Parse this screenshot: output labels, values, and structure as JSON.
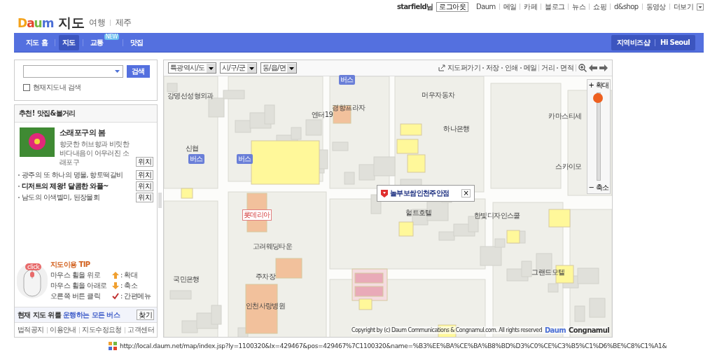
{
  "top_links": {
    "user": "starfield님",
    "logout": "로그아웃",
    "links": [
      "Daum",
      "메일",
      "카페",
      "블로그",
      "뉴스",
      "쇼핑",
      "d&shop",
      "동영상",
      "더보기"
    ]
  },
  "brand": {
    "logo": "Daum",
    "title": "지도",
    "sublinks": [
      "여행",
      "제주"
    ]
  },
  "nav": {
    "tabs": [
      {
        "label": "지도 홈",
        "selected": false
      },
      {
        "label": "지도",
        "selected": true
      },
      {
        "label": "교통",
        "selected": false,
        "badge": "NEW"
      },
      {
        "label": "맛집",
        "selected": false
      }
    ],
    "right_links": [
      "지역비즈샵",
      "Hi Seoul"
    ]
  },
  "search": {
    "button": "검색",
    "option_label": "현재지도내 검색",
    "option_checked": false
  },
  "recommend": {
    "title": "추천! 맛집&볼거리",
    "feature": {
      "title": "소래포구의 봄",
      "description": "향긋한 허브향과 비릿한 바다내음이 어우러진 소래포구",
      "button": "위치"
    },
    "items": [
      {
        "text": "광주의 또 하나의 명물, 향토떡갈비",
        "bold": false,
        "button": "위치"
      },
      {
        "text": "디저트의 제왕! 달콤한 와플~",
        "bold": true,
        "button": "위치"
      },
      {
        "text": "남도의 이색별미, 된장물회",
        "bold": false,
        "button": "위치"
      }
    ]
  },
  "tip": {
    "bubble": "click",
    "title": "지도이용 TIP",
    "rows": [
      {
        "kind": "up",
        "action": "마우스 휠을 위로",
        "result": ": 확대"
      },
      {
        "kind": "down",
        "action": "마우스 휠을 아래로",
        "result": ": 축소"
      },
      {
        "kind": "check",
        "action": "오른쪽 버튼 클릭",
        "result": ": 간편메뉴"
      }
    ]
  },
  "bus": {
    "text": "현재 지도 위를 **운행하는 모든 버스**",
    "button": "찾기"
  },
  "footer_links": [
    "법적공지",
    "이용안내",
    "지도수정요청",
    "고객센터"
  ],
  "map": {
    "selects": [
      "특광역시/도",
      "시/구/군",
      "동/읍/면"
    ],
    "tools": [
      "지도퍼가기",
      "저장",
      "인쇄",
      "메일",
      "거리",
      "면적"
    ],
    "labels": [
      "강명선성형외과",
      "엔터19",
      "경향프라자",
      "머우자동차",
      "하나은행",
      "카마스티세",
      "신협",
      "스카이모",
      "헐트호텔",
      "한빛디자인스쿨",
      "고려웨딩타운",
      "국민은행",
      "주차장",
      "그랜드모텔",
      "인천사랑병원"
    ],
    "bus_stops": [
      "버스",
      "버스",
      "버스"
    ],
    "brand_sign": "롯데리아",
    "popup": {
      "title": "놀부보쌈인천주안점",
      "close": "×"
    },
    "zoom": {
      "in": "+ 확대",
      "out": "− 축소",
      "level": 1
    },
    "copyright": "Copyright by (c) Daum Communications & Congnamul.com. All rights reserved",
    "logos": [
      "Daum",
      "Congnamul"
    ]
  },
  "status_url": "http://local.daum.net/map/index.jsp?ly=1100320&lx=429467&pos=429467%7C1100320&name=%B3%EE%BA%CE%BA%B8%BD%D3%C0%CE%C3%B5%C1%D6%BE%C8%C1%A1&"
}
